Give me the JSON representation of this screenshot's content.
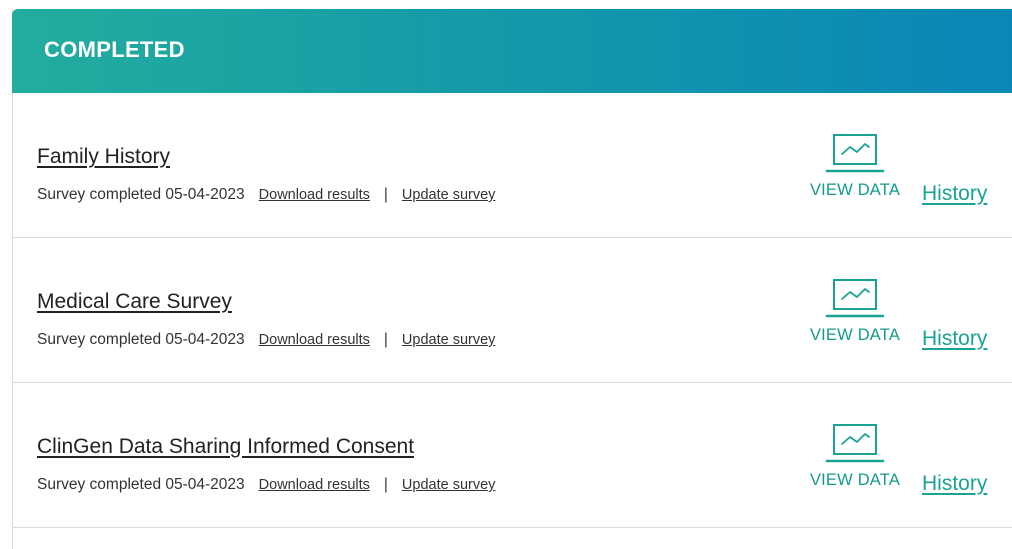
{
  "panel": {
    "title": "COMPLETED"
  },
  "surveys": [
    {
      "title": "Family History",
      "status": "Survey completed 05-04-2023",
      "download_label": "Download results",
      "separator": "|",
      "update_label": "Update survey",
      "view_data_label": "VIEW DATA",
      "history_label": "History"
    },
    {
      "title": "Medical Care Survey",
      "status": "Survey completed 05-04-2023",
      "download_label": "Download results",
      "separator": "|",
      "update_label": "Update survey",
      "view_data_label": "VIEW DATA",
      "history_label": "History"
    },
    {
      "title": "ClinGen Data Sharing Informed Consent",
      "status": "Survey completed 05-04-2023",
      "download_label": "Download results",
      "separator": "|",
      "update_label": "Update survey",
      "view_data_label": "VIEW DATA",
      "history_label": "History"
    }
  ],
  "icons": {
    "view_data": "chart-laptop-icon"
  },
  "colors": {
    "header_gradient_start": "#22ad9e",
    "header_gradient_end": "#0a87b7",
    "accent": "#159a8c",
    "link_text": "#333333",
    "title_text": "#222222",
    "divider": "#d9d9d9"
  }
}
